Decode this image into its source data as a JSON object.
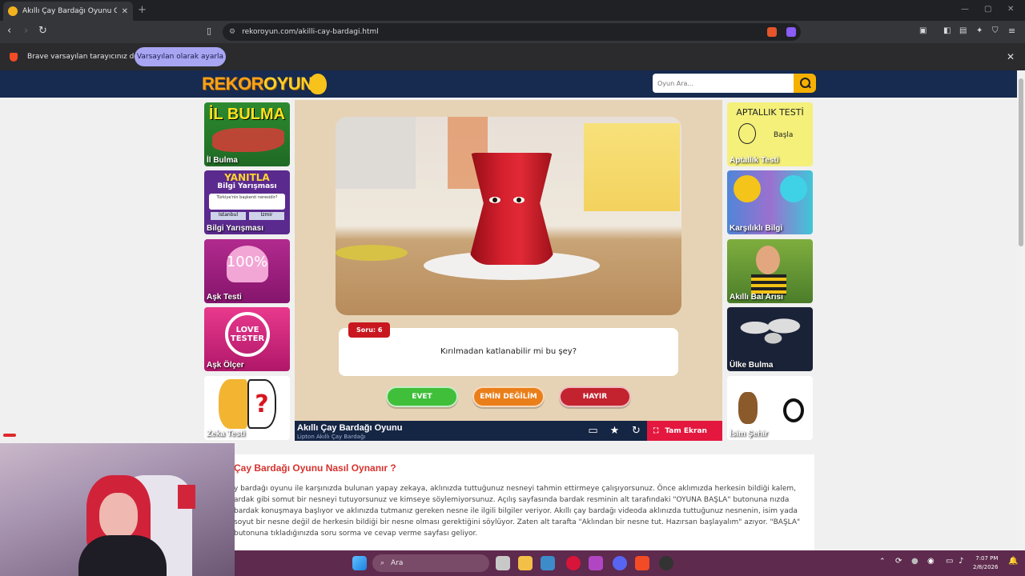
{
  "browser": {
    "tab_title": "Akıllı Çay Bardağı Oyunu Oyna",
    "url": "rekoroyun.com/akilli-cay-bardagi.html",
    "info_message": "Brave varsayılan tarayıcınız değil",
    "info_button": "Varsayılan olarak ayarla"
  },
  "site": {
    "logo_a": "REKOR",
    "logo_b": "OYUN",
    "search_placeholder": "Oyun Ara..."
  },
  "left_games": [
    {
      "label": "İl Bulma",
      "banner": "İL BULMA"
    },
    {
      "label": "Bilgi Yarışması",
      "banner": "YANITLA",
      "sub": "Bilgi Yarışması",
      "q": "Türkiye'nin başkenti neresidir?",
      "o1": "İstanbul",
      "o2": "İzmir"
    },
    {
      "label": "Aşk Testi",
      "banner": "100%"
    },
    {
      "label": "Aşk Ölçer",
      "banner": "LOVE TESTER"
    },
    {
      "label": "Zeka Testi"
    }
  ],
  "right_games": [
    {
      "label": "Aptallık Testi",
      "banner": "APTALLIK TESTİ",
      "sub": "Başla"
    },
    {
      "label": "Karşılıklı Bilgi"
    },
    {
      "label": "Akıllı Bal Arısı"
    },
    {
      "label": "Ülke Bulma"
    },
    {
      "label": "İsim Şehir"
    }
  ],
  "game": {
    "question_no": "Soru: 6",
    "question": "Kırılmadan katlanabilir mi bu şey?",
    "answers": [
      "EVET",
      "EMİN DEĞİLİM",
      "HAYIR"
    ],
    "title": "Akıllı Çay Bardağı Oyunu",
    "subtitle": "Lipton Akıllı Çay Bardağı",
    "fullscreen": "Tam Ekran"
  },
  "article": {
    "heading": "Çay Bardağı Oyunu Nasıl Oynanır ?",
    "body": "y bardağı oyunu ile karşınızda bulunan yapay zekaya, aklınızda tuttuğunuz nesneyi tahmin ettirmeye çalışıyorsunuz. Önce aklımızda herkesin bildiği kalem, ardak gibi somut bir nesneyi tutuyorsunuz ve kimseye söylemiyorsunuz. Açılış sayfasında bardak resminin alt tarafındaki \"OYUNA BAŞLA\" butonuna nızda bardak konuşmaya başlıyor ve aklınızda tutmanız gereken nesne ile ilgili bilgiler veriyor. Akıllı çay bardağı videoda aklınızda tuttuğunuz nesnenin, isim yada soyut bir nesne değil de herkesin bildiği bir nesne olması gerektiğini söylüyor. Zaten alt tarafta \"Aklından bir nesne tut. Hazırsan başlayalım\" azıyor. \"BAŞLA\" butonuna tıkladığınızda soru sorma ve cevap verme sayfası geliyor."
  },
  "taskbar": {
    "search": "Ara",
    "time": "7:07 PM",
    "date": "2/8/2026"
  },
  "colors": {
    "site_header": "#172a4f",
    "evet": "#3fbf3a",
    "emin": "#ea7f1a",
    "hayir": "#c2232f",
    "accent": "#d6322e"
  }
}
